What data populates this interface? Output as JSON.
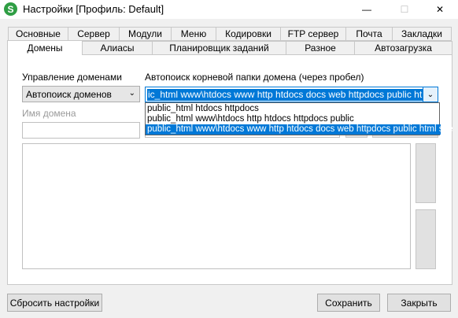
{
  "window": {
    "title": "Настройки [Профиль: Default]",
    "app_icon_letter": "S",
    "minimize": "—",
    "maximize": "☐",
    "close": "✕"
  },
  "tabs_row1": [
    "Основные",
    "Сервер",
    "Модули",
    "Меню",
    "Кодировки",
    "FTP сервер",
    "Почта",
    "Закладки"
  ],
  "tabs_row2": [
    "Домены",
    "Алиасы",
    "Планировщик заданий",
    "Разное",
    "Автозагрузка"
  ],
  "active_tab": "Домены",
  "domains": {
    "management_label": "Управление доменами",
    "management_value": "Автопоиск доменов",
    "autosearch_label": "Автопоиск корневой папки домена (через пробел)",
    "autosearch_value": "ic_html www\\htdocs www http htdocs docs web httpdocs public html site",
    "options": [
      "public_html htdocs httpdocs",
      "public_html www\\htdocs http htdocs httpdocs public",
      "public_html www\\htdocs www http htdocs docs web httpdocs public html site"
    ],
    "selected_option_index": 2,
    "domain_name_label": "Имя домена",
    "domain_name_value": ""
  },
  "footer": {
    "reset_label": "Сбросить настройки",
    "save_label": "Сохранить",
    "close_label": "Закрыть"
  },
  "colors": {
    "selection": "#0078d7",
    "app_icon": "#2f9e44"
  }
}
